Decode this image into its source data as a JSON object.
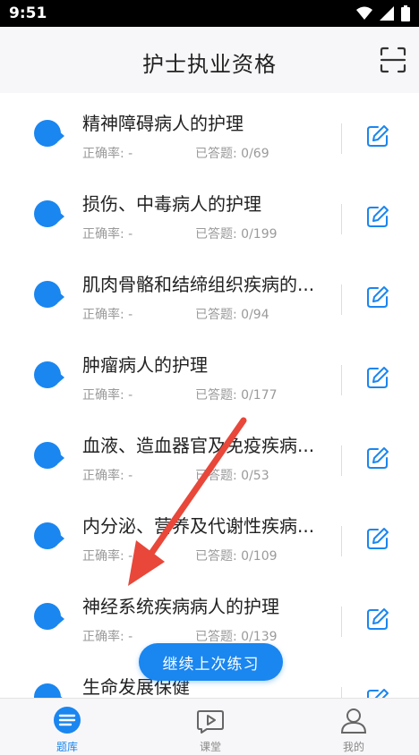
{
  "status_bar": {
    "time": "9:51"
  },
  "header": {
    "title": "护士执业资格",
    "scan_icon": "scan-icon"
  },
  "chapters": [
    {
      "name": "精神障碍病人的护理",
      "rate_label": "正确率: -",
      "answered_label": "已答题: 0/69"
    },
    {
      "name": "损伤、中毒病人的护理",
      "rate_label": "正确率: -",
      "answered_label": "已答题: 0/199"
    },
    {
      "name": "肌肉骨骼和结缔组织疾病的...",
      "rate_label": "正确率: -",
      "answered_label": "已答题: 0/94"
    },
    {
      "name": "肿瘤病人的护理",
      "rate_label": "正确率: -",
      "answered_label": "已答题: 0/177"
    },
    {
      "name": "血液、造血器官及免疫疾病...",
      "rate_label": "正确率: -",
      "answered_label": "已答题: 0/53"
    },
    {
      "name": "内分泌、营养及代谢性疾病...",
      "rate_label": "正确率: -",
      "answered_label": "已答题: 0/109"
    },
    {
      "name": "神经系统疾病病人的护理",
      "rate_label": "正确率: -",
      "answered_label": "已答题: 0/139"
    },
    {
      "name": "生命发展保健",
      "rate_label": "",
      "answered_label": ""
    }
  ],
  "continue_button": {
    "label": "继续上次练习"
  },
  "tabs": [
    {
      "label": "题库",
      "icon": "question-bank-icon",
      "active": true
    },
    {
      "label": "课堂",
      "icon": "video-class-icon",
      "active": false
    },
    {
      "label": "我的",
      "icon": "profile-icon",
      "active": false
    }
  ],
  "colors": {
    "accent": "#1a86f0",
    "annotation_arrow": "#e8473a"
  }
}
